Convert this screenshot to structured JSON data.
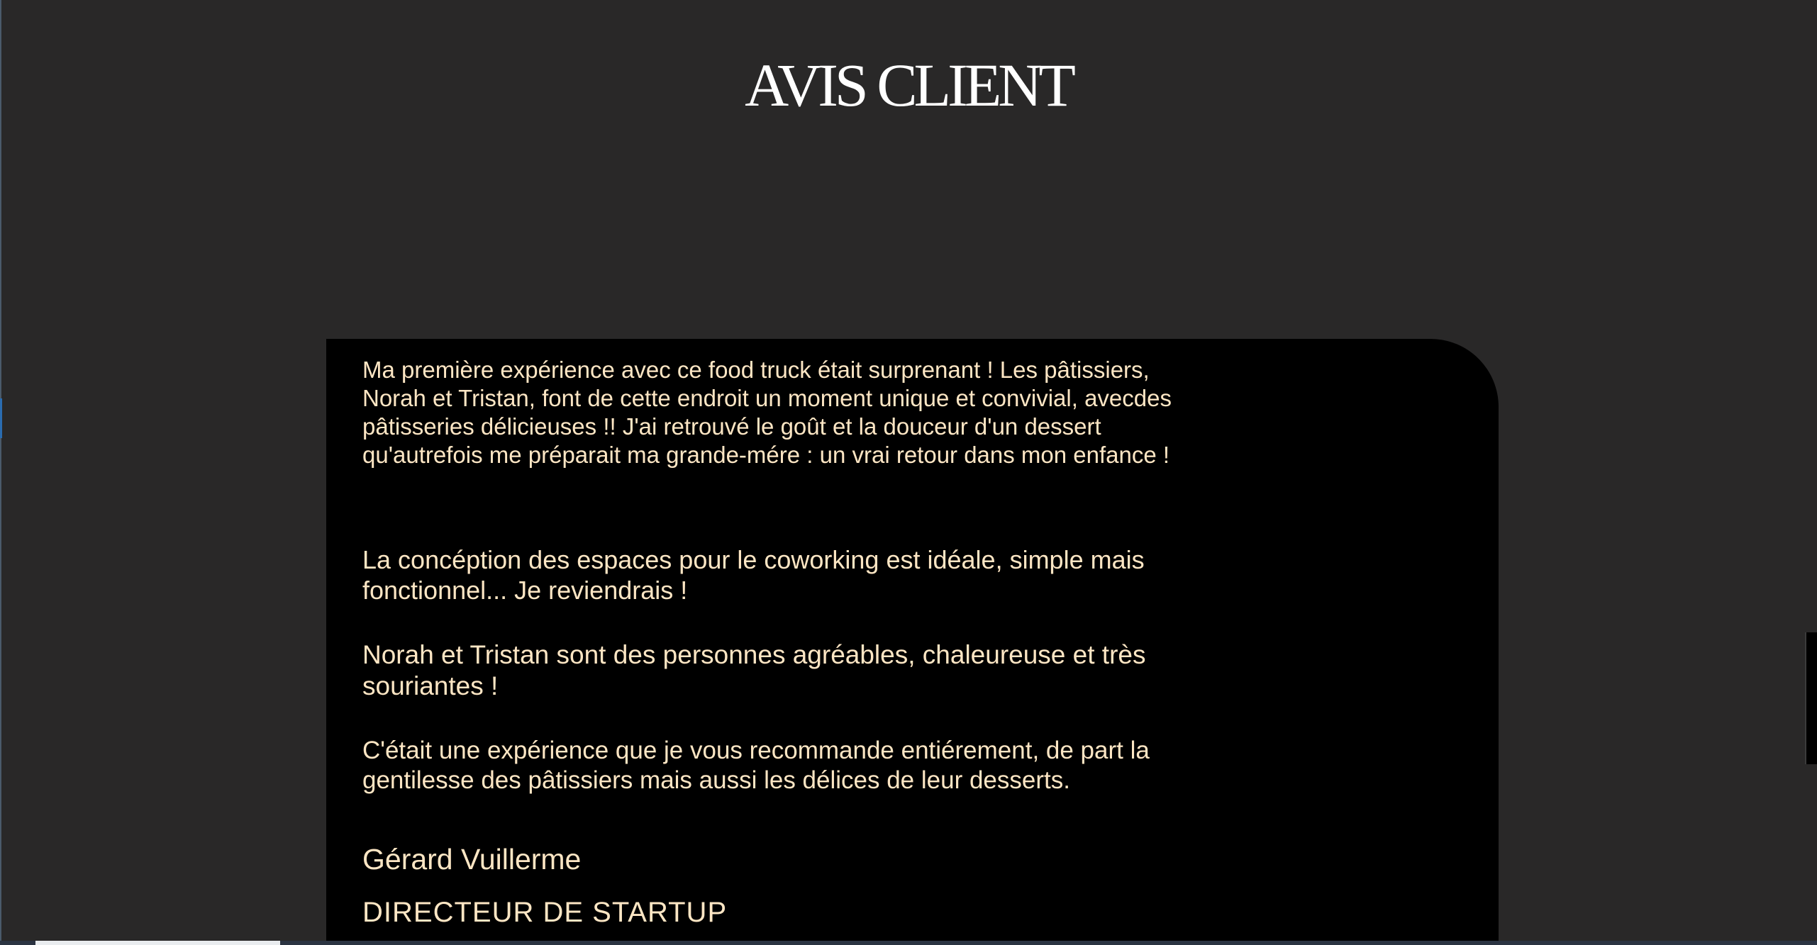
{
  "header": {
    "title": "AVIS CLIENT"
  },
  "review": {
    "paragraphs": [
      "Ma première expérience avec ce food truck était surprenant ! Les pâtissiers, Norah et Tristan, font de cette endroit un moment unique et convivial, avecdes pâtisseries délicieuses !! J'ai retrouvé le goût et la douceur d'un dessert qu'autrefois me préparait ma grande-mére : un vrai retour dans mon enfance !",
      "La concéption des espaces pour le coworking est idéale, simple mais fonctionnel... Je reviendrais !",
      "Norah et Tristan sont des personnes agréables, chaleureuse et très souriantes !",
      "C'était une expérience que je vous recommande entiérement, de part la gentilesse des pâtissiers mais aussi les délices de leur desserts."
    ],
    "author_name": "Gérard Vuillerme",
    "author_role": "DIRECTEUR DE STARTUP"
  },
  "colors": {
    "page_background": "#292828",
    "card_background": "#000000",
    "title_text": "#ffffff",
    "review_text": "#fde6c4"
  }
}
